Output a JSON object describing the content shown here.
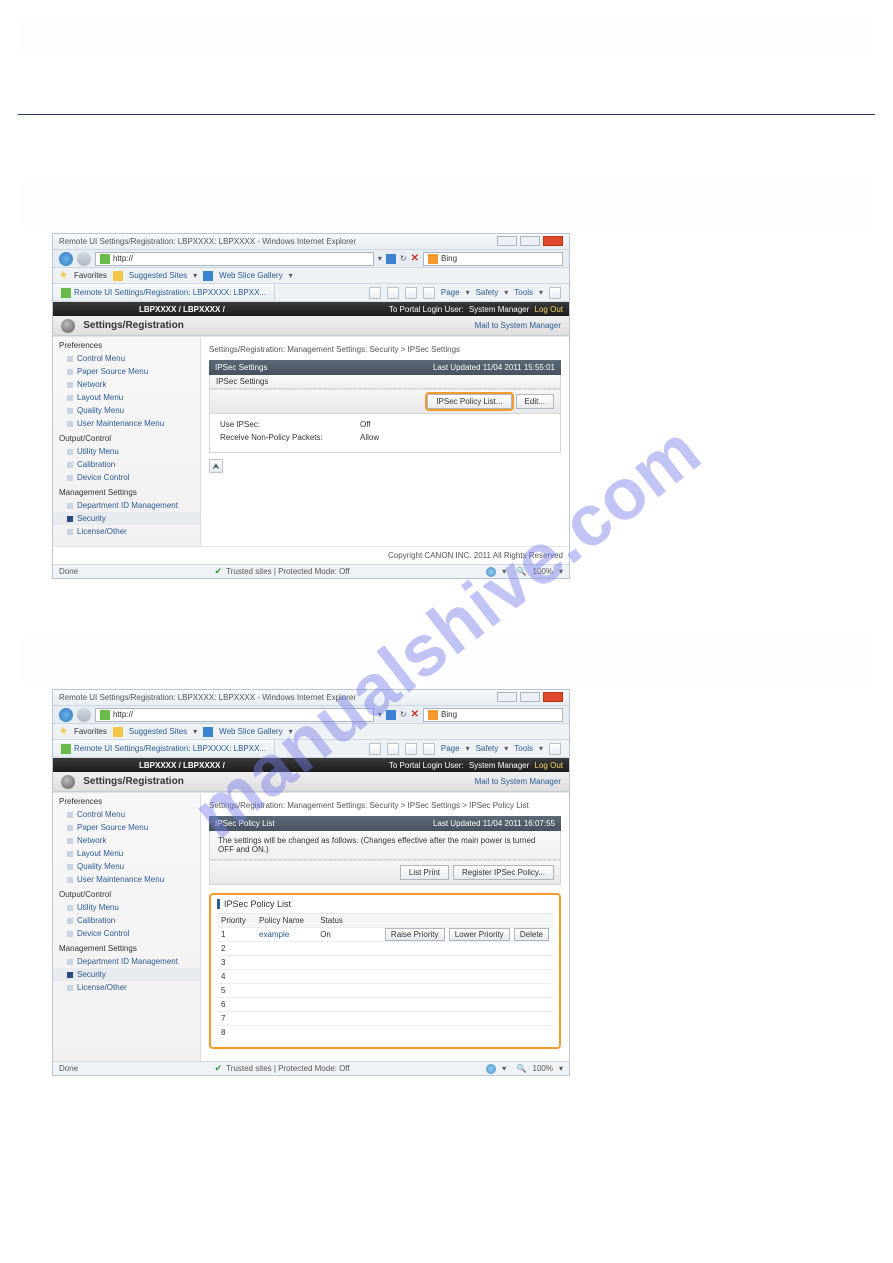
{
  "watermark": "manualshive.com",
  "chrome": {
    "title": "Remote UI Settings/Registration: LBPXXXX: LBPXXXX - Windows Internet Explorer",
    "url_prefix": "http://",
    "search_engine": "Bing",
    "favorites_label": "Favorites",
    "suggested_sites": "Suggested Sites",
    "web_slice": "Web Slice Gallery",
    "tab_label": "Remote UI Settings/Registration: LBPXXXX: LBPXX...",
    "page_label": "Page",
    "safety_label": "Safety",
    "tools_label": "Tools",
    "done": "Done",
    "trusted": "Trusted sites | Protected Mode: Off",
    "zoom": "100%"
  },
  "app": {
    "breadcrumb_top": "LBPXXXX / LBPXXXX /",
    "to_portal": "To Portal",
    "login_user_label": "Login User:",
    "login_user": "System Manager",
    "logout": "Log Out",
    "settings_reg": "Settings/Registration",
    "mail": "Mail to System Manager",
    "sidebar": {
      "preferences": "Preferences",
      "items1": [
        "Control Menu",
        "Paper Source Menu",
        "Network",
        "Layout Menu",
        "Quality Menu",
        "User Maintenance Menu"
      ],
      "output": "Output/Control",
      "items2": [
        "Utility Menu",
        "Calibration",
        "Device Control"
      ],
      "mgmt": "Management Settings",
      "items3": [
        "Department ID Management",
        "Security",
        "License/Other"
      ]
    },
    "copyright": "Copyright CANON INC. 2011 All Rights Reserved"
  },
  "s1": {
    "crumb": "Settings/Registration: Management Settings: Security > IPSec Settings",
    "panel_title": "IPSec Settings",
    "last_updated_label": "Last Updated",
    "last_updated": "11/04 2011 15:55:01",
    "subpanel_title": "IPSec Settings",
    "btn_policy_list": "IPSec Policy List...",
    "btn_edit": "Edit...",
    "kv": [
      {
        "k": "Use IPSec:",
        "v": "Off"
      },
      {
        "k": "Receive Non-Policy Packets:",
        "v": "Allow"
      }
    ]
  },
  "s2": {
    "crumb": "Settings/Registration: Management Settings: Security > IPSec Settings > IPSec Policy List",
    "panel_title": "IPSec Policy List",
    "last_updated_label": "Last Updated",
    "last_updated": "11/04 2011 16:07:55",
    "note": "The settings will be changed as follows. (Changes effective after the main power is turned OFF and ON.)",
    "btn_list_print": "List Print",
    "btn_register": "Register IPSec Policy...",
    "policy_title": "IPSec Policy List",
    "cols": [
      "Priority",
      "Policy Name",
      "Status"
    ],
    "rows": [
      {
        "priority": "1",
        "name": "example",
        "status": "On",
        "btns": [
          "Raise Priority",
          "Lower Priority",
          "Delete"
        ]
      },
      {
        "priority": "2",
        "name": "",
        "status": ""
      },
      {
        "priority": "3",
        "name": "",
        "status": ""
      },
      {
        "priority": "4",
        "name": "",
        "status": ""
      },
      {
        "priority": "5",
        "name": "",
        "status": ""
      },
      {
        "priority": "6",
        "name": "",
        "status": ""
      },
      {
        "priority": "7",
        "name": "",
        "status": ""
      },
      {
        "priority": "8",
        "name": "",
        "status": ""
      }
    ]
  }
}
